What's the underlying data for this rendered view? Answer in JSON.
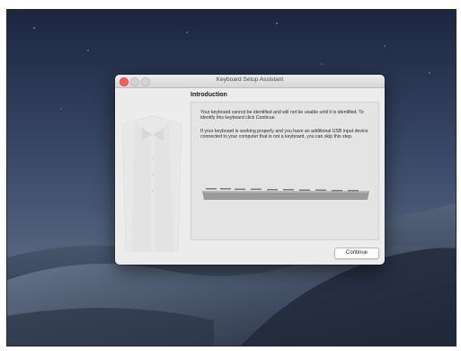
{
  "window": {
    "title": "Keyboard Setup Assistant",
    "traffic_lights": [
      "close",
      "minimize",
      "zoom"
    ]
  },
  "content": {
    "heading": "Introduction",
    "paragraph1": "Your keyboard cannot be identified and will not be usable until it is identified. To identify this keyboard click Continue.",
    "paragraph2": "If your keyboard is working properly and you have an additional USB input device connected to your computer that is not a keyboard, you can skip this step."
  },
  "buttons": {
    "continue": "Continue"
  },
  "colors": {
    "close_button": "#fc5f57",
    "window_background": "#ececec"
  },
  "icons": {
    "sidebar": "tuxedo-illustration",
    "keyboard": "keyboard-illustration"
  }
}
